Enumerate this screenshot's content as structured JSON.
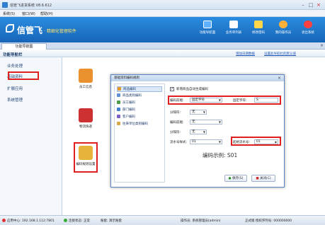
{
  "window": {
    "title": "信管飞进货系统 V8.6.612",
    "controls": [
      "–",
      "□",
      "×"
    ]
  },
  "menu": [
    "系统(S)",
    "窗口(W)",
    "帮助(H)"
  ],
  "brand": {
    "logo": "信管飞",
    "subtitle": "· 精细化管理软件"
  },
  "toolbar": [
    {
      "label": "功能导航面",
      "color": "#5fb0ff"
    },
    {
      "label": "业务单列表",
      "color": "#ffffff"
    },
    {
      "label": "修改密码",
      "color": "#ffd54a"
    },
    {
      "label": "我的操作员",
      "color": "#ffb03a"
    },
    {
      "label": "退出系统",
      "color": "#ff4040"
    }
  ],
  "tab": {
    "label": "功能导航图",
    "close": "×"
  },
  "nav": {
    "title": "功能导航栏",
    "links": [
      "增加日期数据",
      "设置此导航栏的默认值"
    ]
  },
  "sidebar": {
    "items": [
      "业务处理",
      "基础资料",
      "扩展应用",
      "系统管理"
    ],
    "selected": "基础资料"
  },
  "modules": [
    {
      "label": "员工信息",
      "color": "#e9902f"
    },
    {
      "label": "物流快递",
      "color": "#cc3030"
    },
    {
      "label": "编码规则设置",
      "color": "#e8b33a"
    }
  ],
  "dialog": {
    "title": "基础资料编码规则",
    "close": "×",
    "tree": [
      {
        "label": "商品编码",
        "color": "#e39a2b"
      },
      {
        "label": "商品类别编码",
        "color": "#5d8fd6"
      },
      {
        "label": "员工编码",
        "color": "#4a9b4a"
      },
      {
        "label": "部门编码",
        "color": "#3f7fcf"
      },
      {
        "label": "客户编码",
        "color": "#7a5fc4"
      },
      {
        "label": "往来单位类别编码",
        "color": "#d9a84a"
      }
    ],
    "tree_selected": "商品编码",
    "form": {
      "auto_label": "新增商品自动生成编码",
      "prefix_label": "编码前缀:",
      "prefix_value": "固定字符",
      "fixed_label": "固定字符:",
      "fixed_value": "S",
      "sep1_label": "分隔符:",
      "sep1_value": "无",
      "mid_label": "编码前缀:",
      "mid_value": "无",
      "sep2_label": "分隔符:",
      "sep2_value": "无",
      "serial_label": "流水号样式:",
      "serial_value": "01",
      "start_label": "起始流水号:",
      "start_value": "01",
      "example_label": "编码示例:",
      "example_value": "S01"
    },
    "buttons": {
      "save": "保存(S)",
      "close": "关闭(C)"
    }
  },
  "status": {
    "center": "应用中心: 192.168.1.112:7801",
    "conn": "连接状态: 正常",
    "account": "账套: 演示账套",
    "operator": "操作员: 系统管理员(admin)",
    "edition": "正式版 授权序列号: 000000000"
  }
}
